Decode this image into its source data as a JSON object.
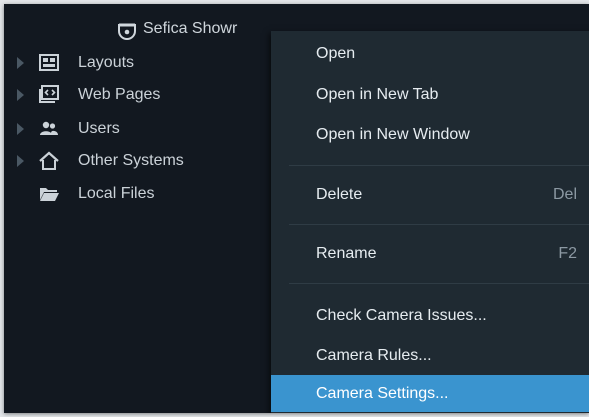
{
  "tree": {
    "server_name": "Sefica Showr",
    "items": [
      {
        "label": "Layouts",
        "icon": "layouts-icon",
        "expandable": true
      },
      {
        "label": "Web Pages",
        "icon": "web-pages-icon",
        "expandable": true
      },
      {
        "label": "Users",
        "icon": "users-icon",
        "expandable": true
      },
      {
        "label": "Other Systems",
        "icon": "other-systems-icon",
        "expandable": true
      },
      {
        "label": "Local Files",
        "icon": "folder-icon",
        "expandable": false
      }
    ]
  },
  "context_menu": {
    "items": [
      {
        "label": "Open",
        "shortcut": ""
      },
      {
        "label": "Open in New Tab",
        "shortcut": ""
      },
      {
        "label": "Open in New Window",
        "shortcut": ""
      },
      {
        "label": "Delete",
        "shortcut": "Del"
      },
      {
        "label": "Rename",
        "shortcut": "F2"
      },
      {
        "label": "Check Camera Issues...",
        "shortcut": ""
      },
      {
        "label": "Camera Rules...",
        "shortcut": ""
      },
      {
        "label": "Camera Settings...",
        "shortcut": ""
      }
    ],
    "selected_index": 7
  },
  "colors": {
    "background": "#121820",
    "menu_background": "#1f2a32",
    "highlight": "#3a94cf"
  }
}
